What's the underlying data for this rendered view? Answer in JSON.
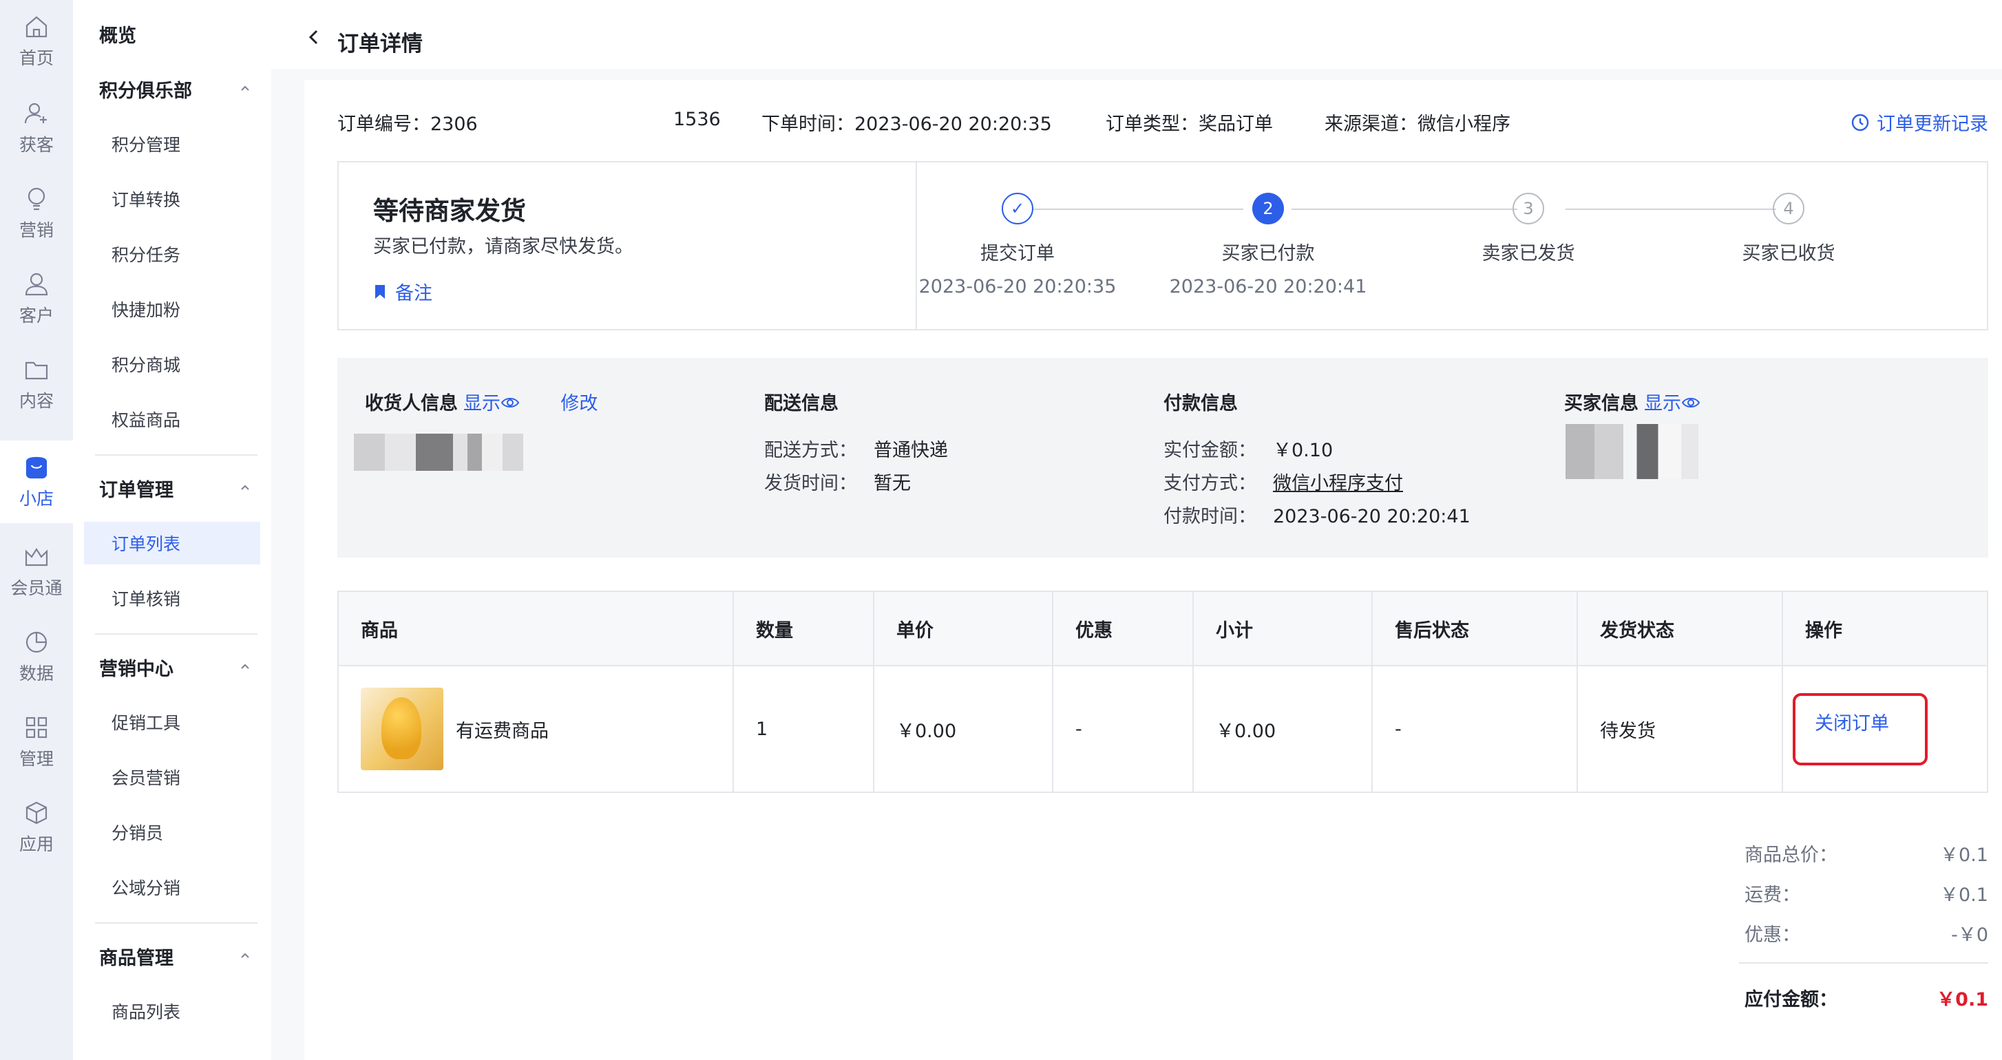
{
  "rail": [
    {
      "label": "首页",
      "icon": "home-icon"
    },
    {
      "label": "获客",
      "icon": "user-add-icon"
    },
    {
      "label": "营销",
      "icon": "bulb-icon"
    },
    {
      "label": "客户",
      "icon": "user-icon"
    },
    {
      "label": "内容",
      "icon": "folder-icon"
    },
    {
      "label": "小店",
      "icon": "shop-icon",
      "active": true
    },
    {
      "label": "会员通",
      "icon": "crown-icon"
    },
    {
      "label": "数据",
      "icon": "pie-chart-icon"
    },
    {
      "label": "管理",
      "icon": "grid-icon"
    },
    {
      "label": "应用",
      "icon": "cube-icon"
    }
  ],
  "sidebar": {
    "overview": "概览",
    "groups": [
      {
        "title": "积分俱乐部",
        "items": [
          "积分管理",
          "订单转换",
          "积分任务",
          "快捷加粉",
          "积分商城",
          "权益商品"
        ]
      },
      {
        "title": "订单管理",
        "items": [
          "订单列表",
          "订单核销"
        ]
      },
      {
        "title": "营销中心",
        "items": [
          "促销工具",
          "会员营销",
          "分销员",
          "公域分销"
        ]
      },
      {
        "title": "商品管理",
        "items": [
          "商品列表"
        ]
      }
    ],
    "active_item": "订单列表"
  },
  "header": {
    "back_icon": "chevron-left-icon",
    "title": "订单详情"
  },
  "order_meta": {
    "order_no_label": "订单编号：",
    "order_no_start": "2306",
    "order_no_end": "1536",
    "order_time_label": "下单时间：",
    "order_time": "2023-06-20 20:20:35",
    "order_type_label": "订单类型：",
    "order_type": "奖品订单",
    "source_label": "来源渠道：",
    "source": "微信小程序",
    "update_log": "订单更新记录"
  },
  "status": {
    "title": "等待商家发货",
    "desc": "买家已付款，请商家尽快发货。",
    "note": "备注",
    "steps": [
      {
        "index": "✓",
        "label": "提交订单",
        "time": "2023-06-20 20:20:35",
        "state": "done"
      },
      {
        "index": "2",
        "label": "买家已付款",
        "time": "2023-06-20 20:20:41",
        "state": "current"
      },
      {
        "index": "3",
        "label": "卖家已发货",
        "time": "",
        "state": "todo"
      },
      {
        "index": "4",
        "label": "买家已收货",
        "time": "",
        "state": "todo"
      }
    ]
  },
  "receiver": {
    "title": "收货人信息",
    "show": "显示",
    "edit": "修改"
  },
  "delivery": {
    "title": "配送信息",
    "method_label": "配送方式：",
    "method": "普通快递",
    "time_label": "发货时间：",
    "time": "暂无"
  },
  "payment": {
    "title": "付款信息",
    "amount_label": "实付金额：",
    "amount": "￥0.10",
    "method_label": "支付方式：",
    "method": "微信小程序支付",
    "time_label": "付款时间：",
    "time": "2023-06-20 20:20:41"
  },
  "buyer": {
    "title": "买家信息",
    "show": "显示"
  },
  "table": {
    "headers": [
      "商品",
      "数量",
      "单价",
      "优惠",
      "小计",
      "售后状态",
      "发货状态",
      "操作"
    ],
    "rows": [
      {
        "product": "有运费商品",
        "qty": "1",
        "price": "￥0.00",
        "discount": "-",
        "subtotal": "￥0.00",
        "after_sale": "-",
        "ship_status": "待发货",
        "action": "关闭订单"
      }
    ]
  },
  "summary": {
    "goods_total_label": "商品总价：",
    "goods_total": "￥0.1",
    "freight_label": "运费：",
    "freight": "￥0.1",
    "discount_label": "优惠：",
    "discount": "-￥0",
    "payable_label": "应付金额：",
    "payable": "￥0.1"
  },
  "colors": {
    "accent": "#2c5ee8",
    "highlight_border": "#e21b2b",
    "price_red": "#e21b2b"
  }
}
